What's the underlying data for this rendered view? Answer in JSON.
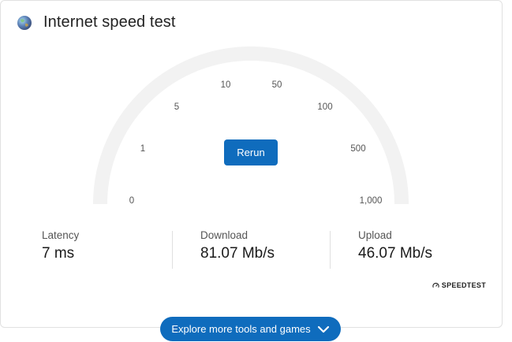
{
  "header": {
    "title": "Internet speed test"
  },
  "gauge": {
    "ticks": [
      "0",
      "1",
      "5",
      "10",
      "50",
      "100",
      "500",
      "1,000"
    ],
    "rerun_label": "Rerun"
  },
  "stats": [
    {
      "label": "Latency",
      "value": "7 ms"
    },
    {
      "label": "Download",
      "value": "81.07 Mb/s"
    },
    {
      "label": "Upload",
      "value": "46.07 Mb/s"
    }
  ],
  "brand": {
    "label": "SPEEDTEST"
  },
  "footer": {
    "explore_label": "Explore more tools and games"
  },
  "colors": {
    "accent": "#0f6cbd",
    "track": "#f2f2f2"
  }
}
